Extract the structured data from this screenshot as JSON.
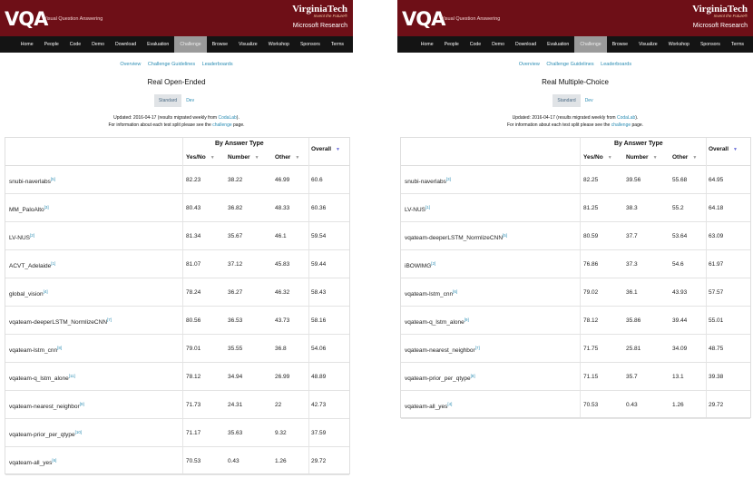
{
  "header": {
    "logo": "VQA",
    "logo_subtitle": "Visual Question Answering",
    "university": "VirginiaTech",
    "tagline": "Invent the Future®",
    "partner": "Microsoft Research"
  },
  "nav": [
    "Home",
    "People",
    "Code",
    "Demo",
    "Download",
    "Evaluation",
    "Challenge",
    "Browse",
    "Visualize",
    "Workshop",
    "Sponsors",
    "Terms"
  ],
  "nav_active": "Challenge",
  "sublinks": [
    "Overview",
    "Challenge Guidelines",
    "Leaderboards"
  ],
  "toggle": {
    "standard": "Standard",
    "dev": "Dev"
  },
  "updated": {
    "line1_prefix": "Updated: 2016-04-17 (results migrated weekly from ",
    "line1_link": "CodaLab",
    "line1_suffix": ").",
    "line2_prefix": "For information about each test split please see the ",
    "line2_link": "challenge",
    "line2_suffix": " page."
  },
  "columns": {
    "group": "By Answer Type",
    "yesno": "Yes/No",
    "number": "Number",
    "other": "Other",
    "overall": "Overall"
  },
  "open_ended": {
    "title": "Real Open-Ended",
    "rows": [
      {
        "name": "snubi-naverlabs",
        "ref": "[5]",
        "yesno": "82.23",
        "number": "38.22",
        "other": "46.99",
        "overall": "60.6"
      },
      {
        "name": "MM_PaloAlto",
        "ref": "[3]",
        "yesno": "80.43",
        "number": "36.82",
        "other": "48.33",
        "overall": "60.36"
      },
      {
        "name": "LV-NUS",
        "ref": "[2]",
        "yesno": "81.34",
        "number": "35.67",
        "other": "46.1",
        "overall": "59.54"
      },
      {
        "name": "ACVT_Adelaide",
        "ref": "[1]",
        "yesno": "81.07",
        "number": "37.12",
        "other": "45.83",
        "overall": "59.44"
      },
      {
        "name": "global_vision",
        "ref": "[4]",
        "yesno": "78.24",
        "number": "36.27",
        "other": "46.32",
        "overall": "58.43"
      },
      {
        "name": "vqateam-deeperLSTM_NormlizeCNN",
        "ref": "[7]",
        "yesno": "80.56",
        "number": "36.53",
        "other": "43.73",
        "overall": "58.16"
      },
      {
        "name": "vqateam-lstm_cnn",
        "ref": "[8]",
        "yesno": "79.01",
        "number": "35.55",
        "other": "36.8",
        "overall": "54.06"
      },
      {
        "name": "vqateam-q_lstm_alone",
        "ref": "[11]",
        "yesno": "78.12",
        "number": "34.94",
        "other": "26.99",
        "overall": "48.89"
      },
      {
        "name": "vqateam-nearest_neighbor",
        "ref": "[9]",
        "yesno": "71.73",
        "number": "24.31",
        "other": "22",
        "overall": "42.73"
      },
      {
        "name": "vqateam-prior_per_qtype",
        "ref": "[10]",
        "yesno": "71.17",
        "number": "35.63",
        "other": "9.32",
        "overall": "37.59"
      },
      {
        "name": "vqateam-all_yes",
        "ref": "[6]",
        "yesno": "70.53",
        "number": "0.43",
        "other": "1.26",
        "overall": "29.72"
      }
    ]
  },
  "multiple_choice": {
    "title": "Real Multiple-Choice",
    "rows": [
      {
        "name": "snubi-naverlabs",
        "ref": "[3]",
        "yesno": "82.25",
        "number": "39.56",
        "other": "55.68",
        "overall": "64.95"
      },
      {
        "name": "LV-NUS",
        "ref": "[1]",
        "yesno": "81.25",
        "number": "38.3",
        "other": "55.2",
        "overall": "64.18"
      },
      {
        "name": "vqateam-deeperLSTM_NormlizeCNN",
        "ref": "[5]",
        "yesno": "80.59",
        "number": "37.7",
        "other": "53.64",
        "overall": "63.09"
      },
      {
        "name": "iBOWIMG",
        "ref": "[2]",
        "yesno": "76.86",
        "number": "37.3",
        "other": "54.6",
        "overall": "61.97"
      },
      {
        "name": "vqateam-lstm_cnn",
        "ref": "[6]",
        "yesno": "79.02",
        "number": "36.1",
        "other": "43.93",
        "overall": "57.57"
      },
      {
        "name": "vqateam-q_lstm_alone",
        "ref": "[9]",
        "yesno": "78.12",
        "number": "35.86",
        "other": "39.44",
        "overall": "55.01"
      },
      {
        "name": "vqateam-nearest_neighbor",
        "ref": "[7]",
        "yesno": "71.75",
        "number": "25.81",
        "other": "34.09",
        "overall": "48.75"
      },
      {
        "name": "vqateam-prior_per_qtype",
        "ref": "[8]",
        "yesno": "71.15",
        "number": "35.7",
        "other": "13.1",
        "overall": "39.38"
      },
      {
        "name": "vqateam-all_yes",
        "ref": "[4]",
        "yesno": "70.53",
        "number": "0.43",
        "other": "1.26",
        "overall": "29.72"
      }
    ]
  }
}
